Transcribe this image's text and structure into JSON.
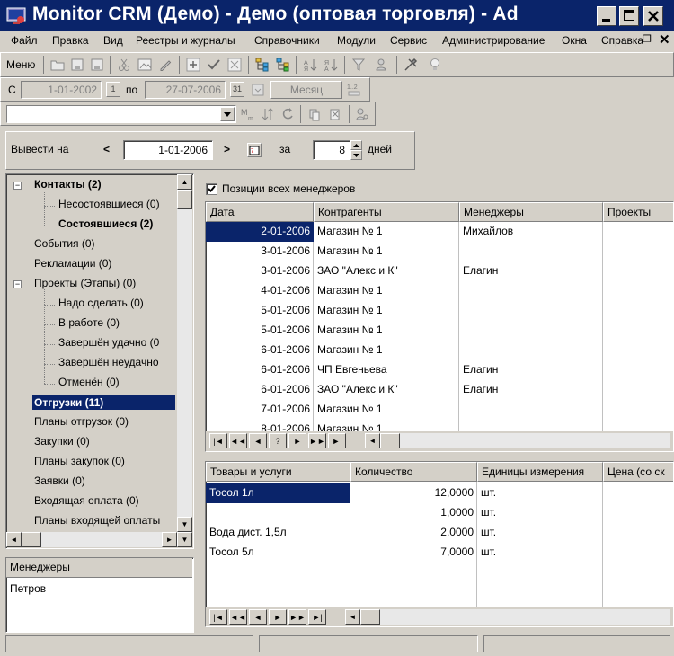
{
  "window": {
    "title": "Monitor CRM (Демо) - Демо (оптовая торговля) - Ad"
  },
  "menu": [
    "Файл",
    "Правка",
    "Вид",
    "Реестры и журналы",
    "Справочники",
    "Модули",
    "Сервис",
    "Администрирование",
    "Окна",
    "Справка"
  ],
  "toolbar1": {
    "menu_label": "Меню"
  },
  "toolbar2": {
    "from_label": "С",
    "from_date": "1-01-2002",
    "from_spin": "1",
    "to_label": "по",
    "to_date": "27-07-2006",
    "to_spin": "31",
    "period_button": "Месяц"
  },
  "toolbar3": {
    "combo_value": ""
  },
  "filter": {
    "label": "Вывести на",
    "prev": "<",
    "date": "1-01-2006",
    "next": ">",
    "for_label": "за",
    "days_value": "8",
    "days_label": "дней"
  },
  "tree": {
    "items": [
      {
        "label": "Контакты (2)",
        "bold": true
      },
      {
        "label": "Несостоявшиеся (0)"
      },
      {
        "label": "Состоявшиеся (2)",
        "bold": true
      },
      {
        "label": "События (0)"
      },
      {
        "label": "Рекламации (0)"
      },
      {
        "label": "Проекты (Этапы) (0)"
      },
      {
        "label": "Надо сделать (0)"
      },
      {
        "label": "В работе (0)"
      },
      {
        "label": "Завершён удачно (0"
      },
      {
        "label": "Завершён неудачно"
      },
      {
        "label": "Отменён (0)"
      },
      {
        "label": "Отгрузки (11)",
        "bold": true,
        "selected": true
      },
      {
        "label": "Планы отгрузок (0)"
      },
      {
        "label": "Закупки (0)"
      },
      {
        "label": "Планы закупок (0)"
      },
      {
        "label": "Заявки (0)"
      },
      {
        "label": "Входящая оплата (0)"
      },
      {
        "label": "Планы входящей оплаты"
      }
    ],
    "expander_minus": "−"
  },
  "managers": {
    "header": "Менеджеры",
    "items": [
      "Петров"
    ]
  },
  "all_managers": {
    "label": "Позиции всех менеджеров",
    "checked": true
  },
  "shipments": {
    "columns": [
      "Дата",
      "Контрагенты",
      "Менеджеры",
      "Проекты"
    ],
    "rows": [
      [
        "2-01-2006",
        "Магазин № 1",
        "Михайлов",
        ""
      ],
      [
        "3-01-2006",
        "Магазин № 1",
        "",
        ""
      ],
      [
        "3-01-2006",
        "ЗАО \"Алекс и К\"",
        "Елагин",
        ""
      ],
      [
        "4-01-2006",
        "Магазин № 1",
        "",
        ""
      ],
      [
        "5-01-2006",
        "Магазин № 1",
        "",
        ""
      ],
      [
        "5-01-2006",
        "Магазин № 1",
        "",
        ""
      ],
      [
        "6-01-2006",
        "Магазин № 1",
        "",
        ""
      ],
      [
        "6-01-2006",
        "ЧП Евгеньева",
        "Елагин",
        ""
      ],
      [
        "6-01-2006",
        "ЗАО \"Алекс и К\"",
        "Елагин",
        ""
      ],
      [
        "7-01-2006",
        "Магазин № 1",
        "",
        ""
      ],
      [
        "8-01-2006",
        "Магазин № 1",
        "",
        ""
      ]
    ],
    "nav": [
      "|◄",
      "◄◄",
      "◄",
      "?",
      "►",
      "►►",
      "►|"
    ]
  },
  "goods": {
    "columns": [
      "Товары и услуги",
      "Количество",
      "Единицы измерения",
      "Цена (со ск"
    ],
    "rows": [
      [
        "Тосол 1л",
        "12,0000",
        "шт.",
        ""
      ],
      [
        "",
        "1,0000",
        "шт.",
        ""
      ],
      [
        "Вода дист. 1,5л",
        "2,0000",
        "шт.",
        ""
      ],
      [
        "Тосол 5л",
        "7,0000",
        "шт.",
        ""
      ]
    ],
    "nav": [
      "|◄",
      "◄◄",
      "◄",
      "►",
      "►►",
      "►|"
    ]
  },
  "colors": {
    "titlebar": "#0a246a",
    "selection": "#0a246a",
    "face": "#d4d0c8"
  }
}
